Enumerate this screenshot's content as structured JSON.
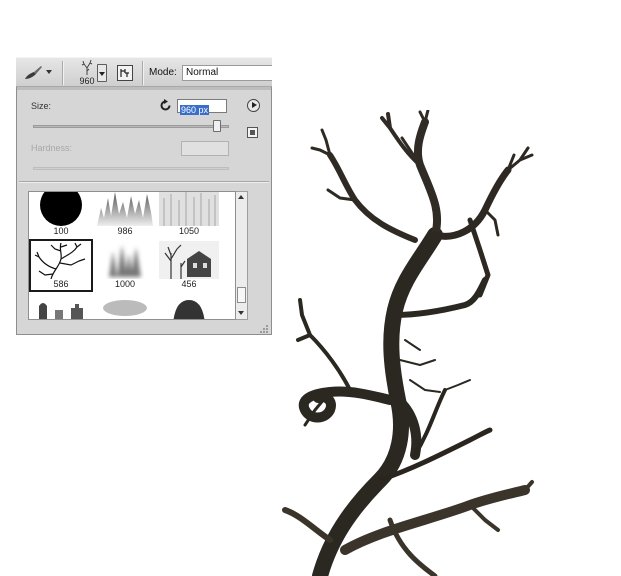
{
  "options_bar": {
    "tool_icon": "brush-icon",
    "brush_preset_size": "960",
    "mode_label": "Mode:",
    "mode_value": "Normal"
  },
  "brush_panel": {
    "size_label": "Size:",
    "size_value": "960 px",
    "size_slider_fraction": 0.94,
    "hardness_label": "Hardness:",
    "hardness_value": "",
    "presets": [
      {
        "value": "100",
        "thumb": "hard-round"
      },
      {
        "value": "986",
        "thumb": "grass"
      },
      {
        "value": "1050",
        "thumb": "forest"
      },
      {
        "value": "586",
        "thumb": "tree-branch"
      },
      {
        "value": "1000",
        "thumb": "soft-spikes"
      },
      {
        "value": "456",
        "thumb": "house"
      }
    ]
  },
  "colors": {
    "panel_bg": "#d6d6d6",
    "selection_blue": "#3a6fc9",
    "tree_ink": "#2b2721"
  }
}
